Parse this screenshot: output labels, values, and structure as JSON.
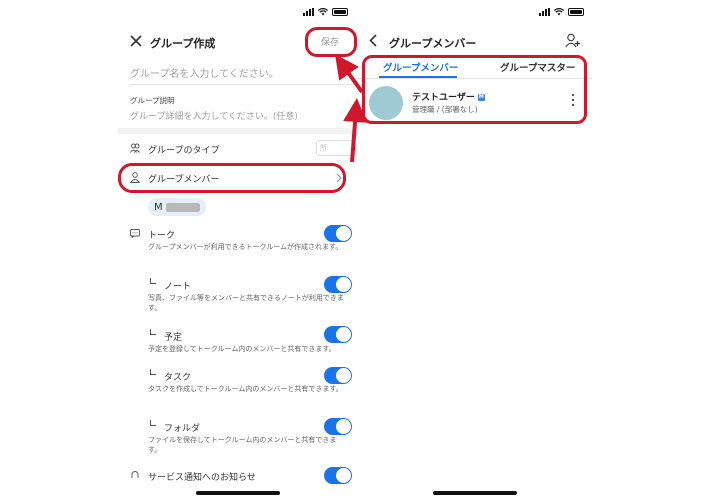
{
  "left": {
    "title": "グループ作成",
    "save_label": "保存",
    "name_placeholder": "グループ名を入力してください。",
    "desc_label": "グループ説明",
    "desc_placeholder": "グループ詳細を入力してください。(任意)",
    "type_label": "グループのタイプ",
    "members_label": "グループメンバー",
    "member_chip_initial": "M",
    "settings": [
      {
        "label": "トーク",
        "desc": "グループメンバーが利用できるトークルームが作成されます。",
        "enabled": true
      },
      {
        "label": "ノート",
        "desc": "写真、ファイル等をメンバーと共有できるノートが利用できます。",
        "enabled": true
      },
      {
        "label": "予定",
        "desc": "予定を登録してトークルーム内のメンバーと共有できます。",
        "enabled": true
      },
      {
        "label": "タスク",
        "desc": "タスクを作成してトークルーム内のメンバーと共有できます。",
        "enabled": true
      },
      {
        "label": "フォルダ",
        "desc": "ファイルを保存してトークルーム内のメンバーと共有できます。",
        "enabled": true
      }
    ],
    "bottom_label": "サービス通知へのお知らせ"
  },
  "right": {
    "title": "グループメンバー",
    "tabs": [
      {
        "label": "グループメンバー",
        "active": true
      },
      {
        "label": "グループマスター",
        "active": false
      }
    ],
    "member": {
      "name": "テストユーザー",
      "badge": "M",
      "role": "管理職 / (部署なし)"
    }
  },
  "colors": {
    "accent": "#1a73e8",
    "highlight": "#d0182c",
    "avatar": "#9fc9d3"
  }
}
